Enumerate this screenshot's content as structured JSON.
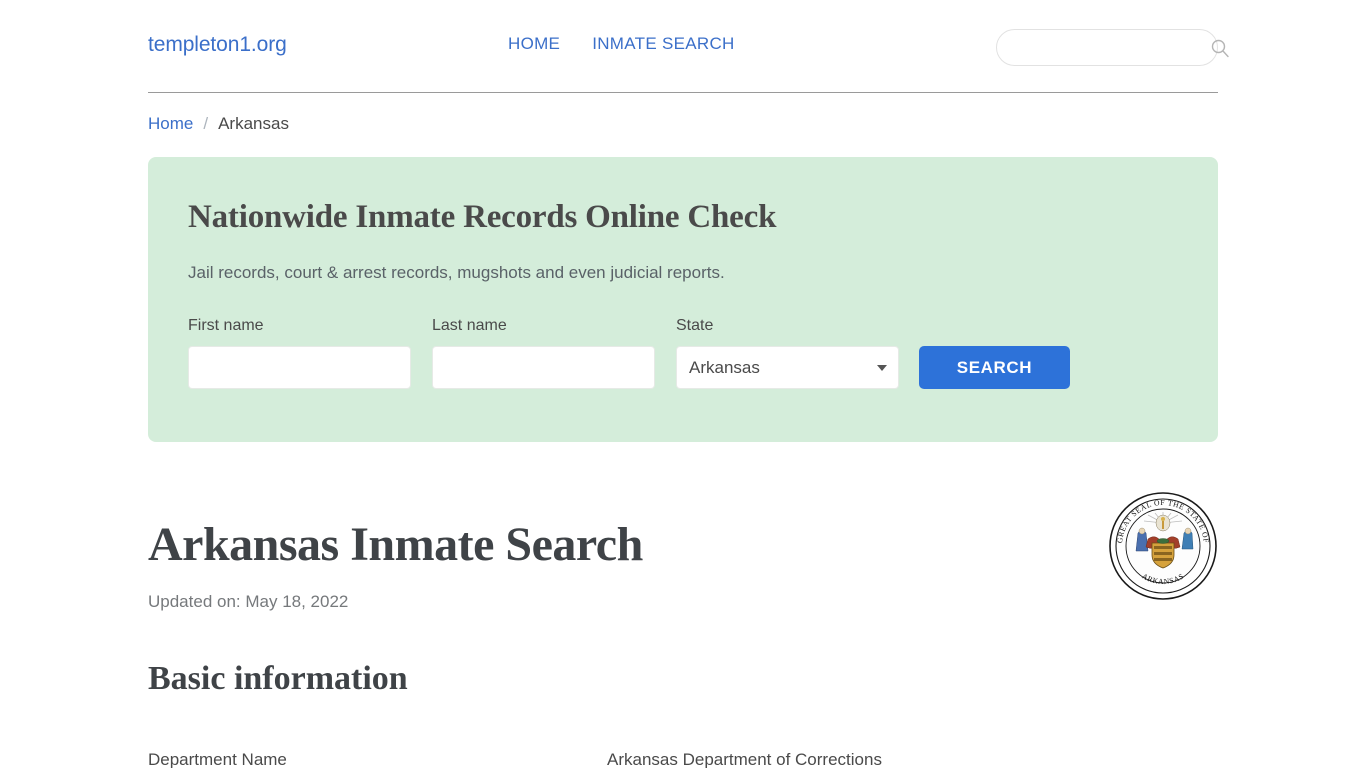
{
  "header": {
    "brand": "templeton1.org",
    "nav": [
      {
        "label": "HOME"
      },
      {
        "label": "INMATE SEARCH"
      }
    ],
    "search": {
      "value": "",
      "placeholder": "",
      "icon": "search-icon"
    }
  },
  "breadcrumb": {
    "home": "Home",
    "separator": "/",
    "current": "Arkansas"
  },
  "search_panel": {
    "title": "Nationwide Inmate Records Online Check",
    "subtitle": "Jail records, court & arrest records, mugshots and even judicial reports.",
    "fields": {
      "first_name": {
        "label": "First name",
        "value": "",
        "placeholder": ""
      },
      "last_name": {
        "label": "Last name",
        "value": "",
        "placeholder": ""
      },
      "state": {
        "label": "State",
        "selected": "Arkansas",
        "options": [
          "Arkansas"
        ],
        "caret_icon": "chevron-down-icon"
      }
    },
    "submit_label": "SEARCH",
    "colors": {
      "panel_background": "#d4edda",
      "submit_background": "#2d72d9",
      "submit_text": "#ffffff"
    }
  },
  "main": {
    "page_title": "Arkansas Inmate Search",
    "updated": "Updated on: May 18, 2022",
    "section_title": "Basic information",
    "info_rows": [
      {
        "label": "Department Name",
        "value": "Arkansas Department of Corrections"
      }
    ],
    "seal": {
      "name": "arkansas-state-seal",
      "caption": "GREAT SEAL OF THE STATE OF ARKANSAS"
    }
  },
  "colors": {
    "link": "#3b6fc9",
    "text": "#4a4a4a",
    "muted": "#76797c",
    "page_background": "#ffffff"
  }
}
